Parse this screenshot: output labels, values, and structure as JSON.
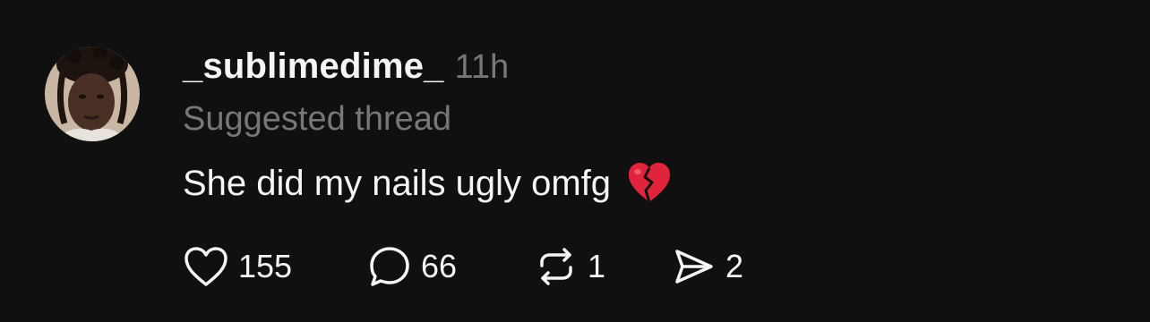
{
  "post": {
    "username": "_sublimedime_",
    "time": "11h",
    "subtitle": "Suggested thread",
    "text": "She did my nails ugly omfg",
    "emoji_icon": "broken-heart-icon",
    "actions": {
      "likes": "155",
      "replies": "66",
      "reposts": "1",
      "shares": "2"
    }
  },
  "colors": {
    "background": "#101010",
    "primary_text": "#f3f5f7",
    "secondary_text": "#777777",
    "broken_heart": "#e0243b"
  }
}
